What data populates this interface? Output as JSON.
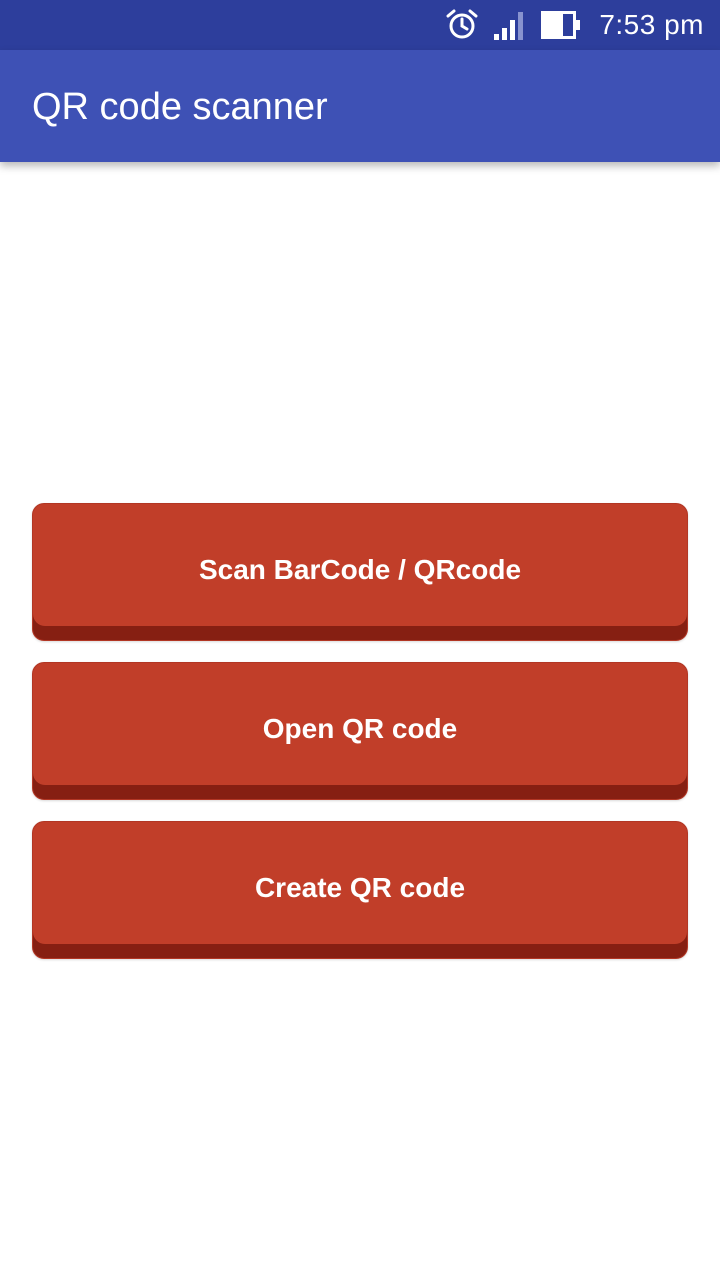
{
  "status_bar": {
    "time": "7:53 pm",
    "icons": [
      "alarm-icon",
      "signal-icon",
      "battery-icon"
    ]
  },
  "app_bar": {
    "title": "QR code scanner"
  },
  "buttons": [
    {
      "label": "Scan BarCode / QRcode"
    },
    {
      "label": "Open QR code"
    },
    {
      "label": "Create QR code"
    }
  ],
  "colors": {
    "status_bar": "#2d3e9c",
    "app_bar": "#3e51b5",
    "button": "#c13e29",
    "button_shadow": "#861f12"
  }
}
